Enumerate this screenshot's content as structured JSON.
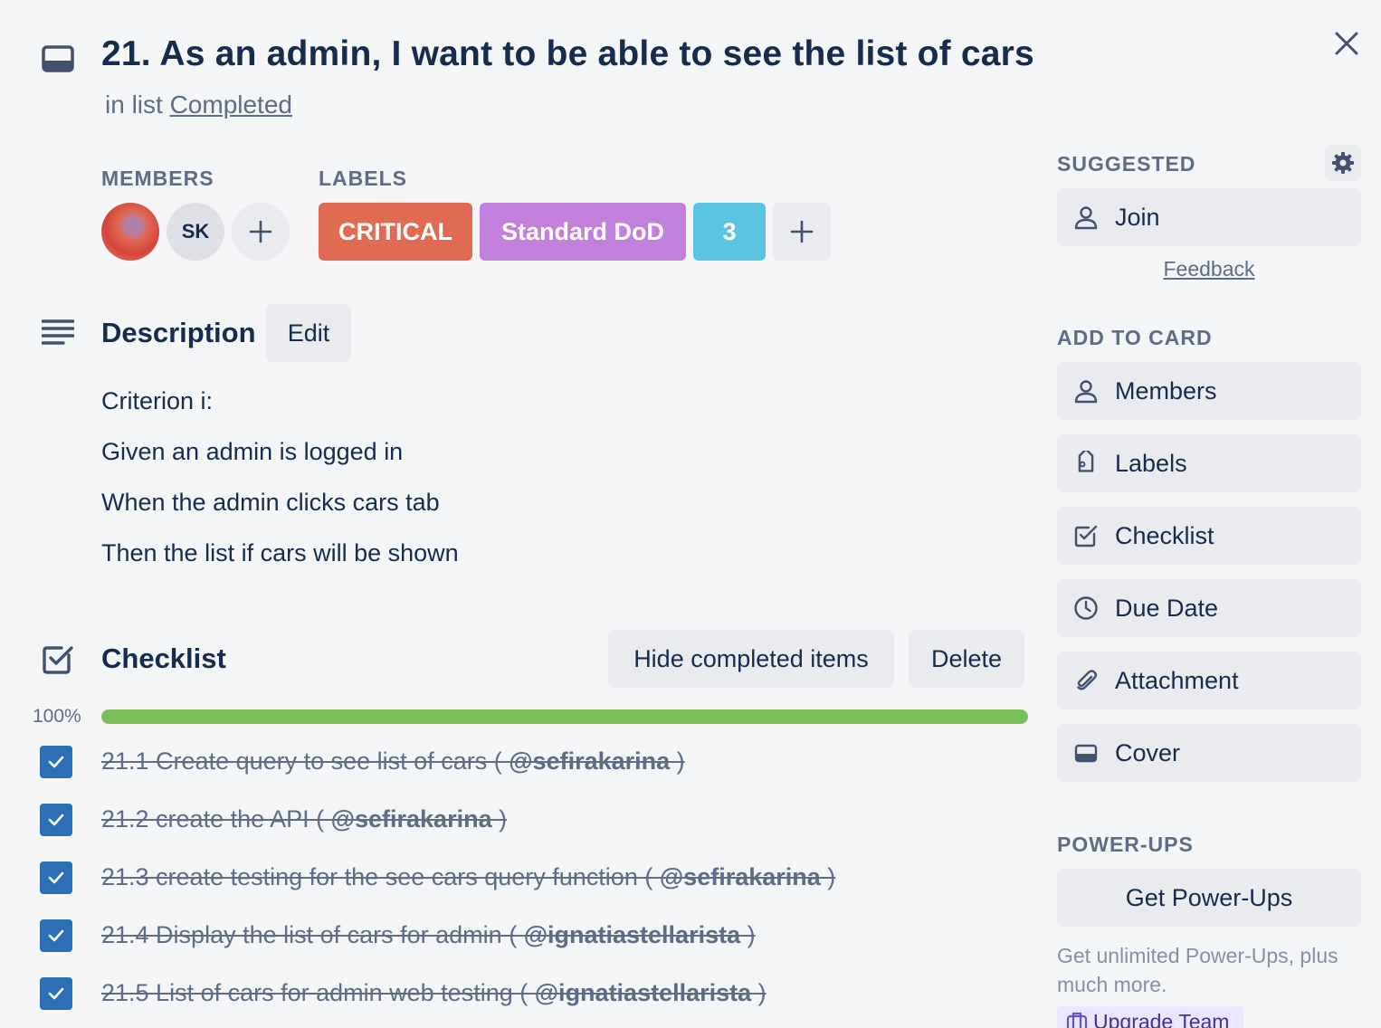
{
  "card": {
    "title": "21. As an admin, I want to be able to see the list of cars",
    "in_list_prefix": "in list",
    "list_name": "Completed"
  },
  "members": {
    "heading": "MEMBERS",
    "initials": "SK"
  },
  "labels": {
    "heading": "LABELS",
    "items": [
      {
        "text": "CRITICAL",
        "color": "#e06a52"
      },
      {
        "text": "Standard DoD",
        "color": "#c37fdc"
      },
      {
        "text": "3",
        "color": "#5bc4e0"
      }
    ]
  },
  "description": {
    "heading": "Description",
    "edit_label": "Edit",
    "lines": [
      "Criterion i:",
      "Given an admin is logged in",
      "When the admin clicks cars tab",
      "Then the list if cars will be shown"
    ]
  },
  "checklist": {
    "heading": "Checklist",
    "hide_label": "Hide completed items",
    "delete_label": "Delete",
    "progress_text": "100%",
    "progress": 1.0,
    "progress_color": "#7bbf5a",
    "items": [
      {
        "text": "21.1 Create query to see list of cars ( ",
        "mention": "@sefirakarina",
        "suffix": " )",
        "checked": true
      },
      {
        "text": "21.2 create the API ( ",
        "mention": "@sefirakarina",
        "suffix": " )",
        "checked": true
      },
      {
        "text": "21.3 create testing for the see cars query function ( ",
        "mention": "@sefirakarina",
        "suffix": " )",
        "checked": true
      },
      {
        "text": "21.4 Display the list of cars for admin ( ",
        "mention": "@ignatiastellarista",
        "suffix": " )",
        "checked": true
      },
      {
        "text": "21.5 List of cars for admin web testing ( ",
        "mention": "@ignatiastellarista",
        "suffix": " )",
        "checked": true
      }
    ]
  },
  "sidebar": {
    "suggested_heading": "SUGGESTED",
    "join_label": "Join",
    "feedback_label": "Feedback",
    "add_heading": "ADD TO CARD",
    "add_items": [
      {
        "label": "Members",
        "icon": "person-icon"
      },
      {
        "label": "Labels",
        "icon": "tag-icon"
      },
      {
        "label": "Checklist",
        "icon": "checklist-icon"
      },
      {
        "label": "Due Date",
        "icon": "clock-icon"
      },
      {
        "label": "Attachment",
        "icon": "paperclip-icon"
      },
      {
        "label": "Cover",
        "icon": "cover-icon"
      }
    ],
    "powerups_heading": "POWER-UPS",
    "get_powerups_label": "Get Power-Ups",
    "powerups_note": "Get unlimited Power-Ups, plus much more.",
    "upgrade_label": "Upgrade Team"
  }
}
